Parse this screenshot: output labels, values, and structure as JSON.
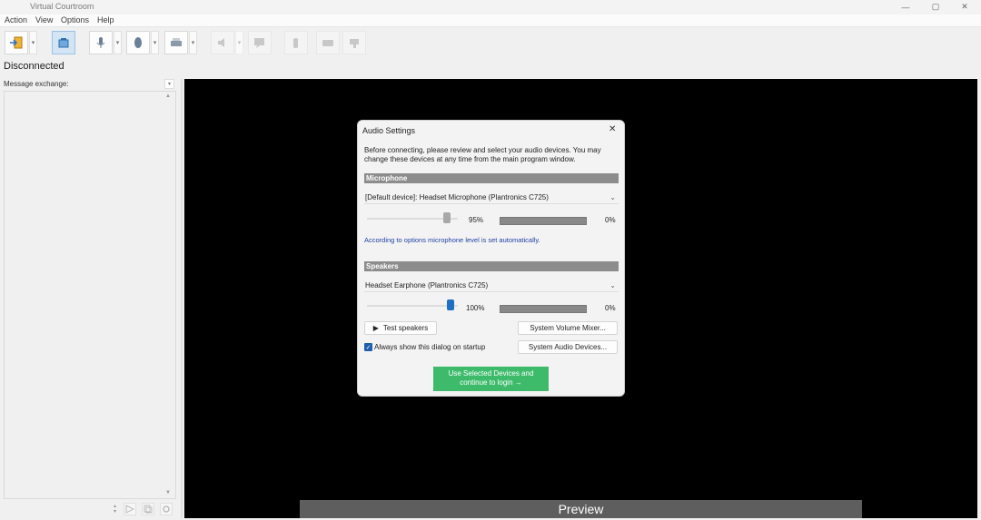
{
  "window": {
    "title": "Virtual Courtroom",
    "controls": {
      "minimize": "—",
      "maximize": "▢",
      "close": "✕"
    }
  },
  "menu": [
    "Action",
    "View",
    "Options",
    "Help"
  ],
  "toolbar": {
    "dropdown_glyph": "▾",
    "icons": [
      "login-icon",
      "courtroom-icon",
      "microphone-icon",
      "handset-icon",
      "printer-icon",
      "speaker-icon",
      "chat-icon",
      "raise-hand-icon",
      "camera-icon",
      "thumbs-down-icon"
    ]
  },
  "status": "Disconnected",
  "message_panel": {
    "label": "Message exchange:",
    "dropdown_glyph": "▾",
    "scroll_up": "▲",
    "scroll_down": "▼"
  },
  "preview": {
    "label": "Preview"
  },
  "dialog": {
    "title": "Audio Settings",
    "close": "✕",
    "intro": "Before connecting, please review and select your audio devices. You may change these devices at any time from the main program window.",
    "microphone": {
      "header": "Microphone",
      "device": "[Default device]: Headset Microphone (Plantronics C725)",
      "level_text": "95%",
      "level": 0.95,
      "meter_text": "0%",
      "note": "According to options microphone level is set automatically."
    },
    "speakers": {
      "header": "Speakers",
      "device": "Headset Earphone (Plantronics C725)",
      "level_text": "100%",
      "level": 1.0,
      "meter_text": "0%"
    },
    "test_speakers": "Test speakers",
    "system_volume_mixer": "System Volume Mixer...",
    "system_audio_devices": "System Audio Devices...",
    "always_show": "Always show this dialog on startup",
    "always_show_checked": true,
    "continue_line1": "Use Selected Devices and",
    "continue_line2": "continue to login →",
    "colors": {
      "accent": "#3dbb6b",
      "checkbox": "#1f5fb0",
      "speaker_thumb": "#1f6fc4",
      "section_header": "#8c8c8c"
    }
  }
}
